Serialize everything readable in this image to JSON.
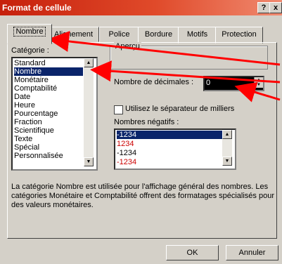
{
  "window": {
    "title": "Format de cellule",
    "help_btn": "?",
    "close_btn": "x"
  },
  "tabs": [
    {
      "label": "Nombre",
      "active": true
    },
    {
      "label": "Alignement",
      "active": false
    },
    {
      "label": "Police",
      "active": false
    },
    {
      "label": "Bordure",
      "active": false
    },
    {
      "label": "Motifs",
      "active": false
    },
    {
      "label": "Protection",
      "active": false
    }
  ],
  "categories": {
    "label": "Catégorie :",
    "items": [
      "Standard",
      "Nombre",
      "Monétaire",
      "Comptabilité",
      "Date",
      "Heure",
      "Pourcentage",
      "Fraction",
      "Scientifique",
      "Texte",
      "Spécial",
      "Personnalisée"
    ],
    "selected": "Nombre"
  },
  "preview": {
    "label": "Aperçu"
  },
  "decimals": {
    "label": "Nombre de décimales :",
    "value": "0"
  },
  "separator": {
    "label": "Utilisez le séparateur de milliers",
    "checked": false
  },
  "negatives": {
    "label": "Nombres négatifs :",
    "items": [
      {
        "text": "-1234",
        "color": "#000000",
        "selected": true
      },
      {
        "text": "1234",
        "color": "#cc0000",
        "selected": false
      },
      {
        "text": "-1234",
        "color": "#000000",
        "selected": false
      },
      {
        "text": "-1234",
        "color": "#cc0000",
        "selected": false
      }
    ]
  },
  "description": "La catégorie Nombre est utilisée pour l'affichage général des nombres. Les catégories Monétaire et Comptabilité offrent des formatages spécialisés pour des valeurs monétaires.",
  "buttons": {
    "ok": "OK",
    "cancel": "Annuler"
  },
  "colors": {
    "title_start": "#c6200c",
    "selection": "#0a246a",
    "arrows": "#ff0000"
  }
}
